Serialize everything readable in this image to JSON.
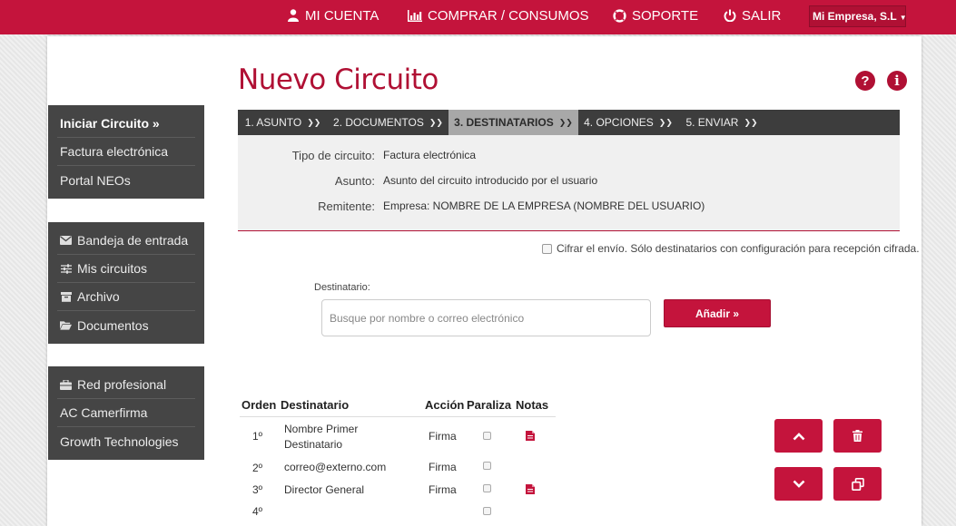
{
  "topbar": {
    "account": "MI CUENTA",
    "purchases": "COMPRAR / CONSUMOS",
    "support": "SOPORTE",
    "logout": "SALIR",
    "company": "Mi Empresa, S.L",
    "accent_color": "#c4143c"
  },
  "sidebar": {
    "group1": [
      {
        "label": "Iniciar Circuito »",
        "active": true
      },
      {
        "label": "Factura electrónica"
      },
      {
        "label": "Portal NEOs"
      }
    ],
    "group2": [
      {
        "label": "Bandeja de entrada",
        "icon": "envelope-icon"
      },
      {
        "label": "Mis circuitos",
        "icon": "sliders-icon"
      },
      {
        "label": "Archivo",
        "icon": "archive-icon"
      },
      {
        "label": "Documentos",
        "icon": "folder-icon"
      }
    ],
    "group3": [
      {
        "label": "Red profesional",
        "icon": "briefcase-icon"
      },
      {
        "label": "AC Camerfirma"
      },
      {
        "label": "Growth Technologies"
      }
    ]
  },
  "page": {
    "title": "Nuevo Circuito"
  },
  "steps": [
    {
      "label": "1. ASUNTO"
    },
    {
      "label": "2. DOCUMENTOS"
    },
    {
      "label": "3. DESTINATARIOS",
      "active": true
    },
    {
      "label": "4. OPCIONES"
    },
    {
      "label": "5. ENVIAR"
    }
  ],
  "summary": {
    "type_label": "Tipo de circuito:",
    "type_value": "Factura electrónica",
    "subject_label": "Asunto:",
    "subject_value": "Asunto del circuito introducido por el usuario",
    "sender_label": "Remitente:",
    "sender_value": "Empresa: NOMBRE DE LA EMPRESA (NOMBRE DEL USUARIO)"
  },
  "encrypt": {
    "label": "Cifrar el envío. Sólo destinatarios con configuración para recepción cifrada.",
    "checked": false
  },
  "recipient": {
    "label": "Destinatario:",
    "placeholder": "Busque por nombre o correo electrónico",
    "add_label": "Añadir »"
  },
  "table": {
    "headers": [
      "Orden",
      "Destinatario",
      "Acción",
      "Paraliza",
      "Notas"
    ],
    "rows": [
      {
        "order": "1º",
        "name": "Nombre Primer Destinatario",
        "action": "Firma",
        "note": true
      },
      {
        "order": "2º",
        "name": "correo@externo.com",
        "action": "Firma",
        "note": false
      },
      {
        "order": "3º",
        "name": "Director General",
        "action": "Firma",
        "note": true
      },
      {
        "order": "4º",
        "name": "",
        "action": "",
        "note": false
      }
    ]
  },
  "actions": [
    "chevron-up-icon",
    "trash-icon",
    "chevron-down-icon",
    "copy-icon"
  ]
}
